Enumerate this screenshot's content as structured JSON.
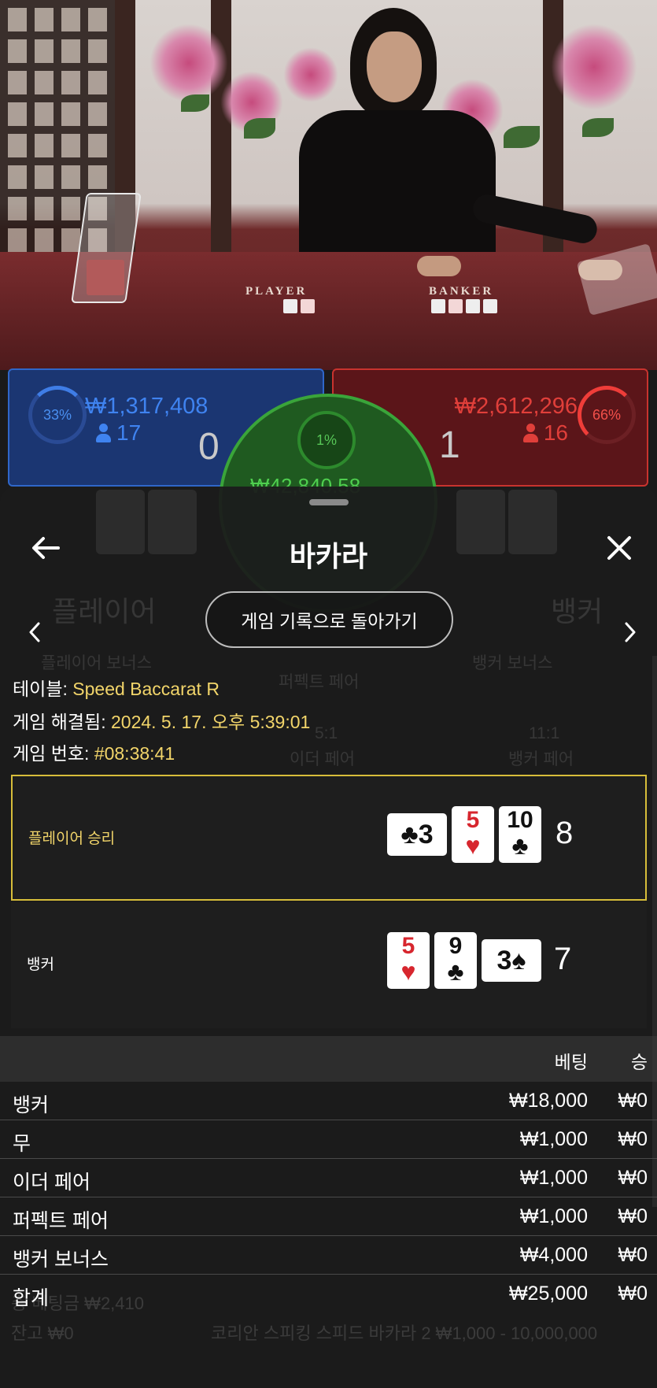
{
  "video": {
    "felt_labels": {
      "player": "PLAYER",
      "banker": "BANKER"
    }
  },
  "stats": {
    "player": {
      "percent": "33%",
      "amount": "₩1,317,408",
      "players": "17",
      "score": "0"
    },
    "banker": {
      "percent": "66%",
      "amount": "₩2,612,296",
      "players": "16",
      "score": "1"
    },
    "tie": {
      "percent": "1%",
      "amount": "₩42,840.58"
    }
  },
  "background_ghost": {
    "player_label": "플레이어",
    "banker_label": "뱅커",
    "player_bonus": "플레이어 보너스",
    "perfect_pair": "퍼펙트 페어",
    "banker_bonus": "뱅커 보너스",
    "either_pair": "이더 페어",
    "banker_pair": "뱅커 페어",
    "either_odds": "5:1",
    "banker_odds": "11:1",
    "balance_line": "잔고 ₩0",
    "bet_line": "총 베팅금 ₩2,410",
    "table_line": "코리안 스피킹 스피드 바카라 2 ₩1,000 - 10,000,000"
  },
  "sheet": {
    "title": "바카라",
    "return_label": "게임 기록으로 돌아가기",
    "info": {
      "table_label": "테이블: ",
      "table_value": "Speed Baccarat R",
      "resolved_label": "게임 해결됨: ",
      "resolved_value": "2024. 5. 17. 오후 5:39:01",
      "round_label": "게임 번호: ",
      "round_value": "#08:38:41"
    },
    "player_hand": {
      "label": "플레이어 승리",
      "cards": [
        {
          "rank": "3",
          "suit": "♣",
          "color": "#111111",
          "orientation": "sideways"
        },
        {
          "rank": "5",
          "suit": "♥",
          "color": "#d7262e",
          "orientation": "upright"
        },
        {
          "rank": "10",
          "suit": "♣",
          "color": "#111111",
          "orientation": "upright"
        }
      ],
      "total": "8"
    },
    "banker_hand": {
      "label": "뱅커",
      "cards": [
        {
          "rank": "5",
          "suit": "♥",
          "color": "#d7262e",
          "orientation": "upright"
        },
        {
          "rank": "9",
          "suit": "♣",
          "color": "#111111",
          "orientation": "upright"
        },
        {
          "rank": "3",
          "suit": "♠",
          "color": "#111111",
          "orientation": "sideways"
        }
      ],
      "total": "7"
    },
    "bets": {
      "col_bet": "베팅",
      "col_win": "승",
      "rows": [
        {
          "name": "뱅커",
          "bet": "₩18,000",
          "win": "₩0"
        },
        {
          "name": "무",
          "bet": "₩1,000",
          "win": "₩0"
        },
        {
          "name": "이더 페어",
          "bet": "₩1,000",
          "win": "₩0"
        },
        {
          "name": "퍼펙트 페어",
          "bet": "₩1,000",
          "win": "₩0"
        },
        {
          "name": "뱅커 보너스",
          "bet": "₩4,000",
          "win": "₩0"
        },
        {
          "name": "합계",
          "bet": "₩25,000",
          "win": "₩0"
        }
      ]
    }
  },
  "colors": {
    "player_blue": "#3f83f0",
    "banker_red": "#e03f3a",
    "tie_green": "#4fcf4f",
    "winner_gold": "#f2d56a"
  }
}
